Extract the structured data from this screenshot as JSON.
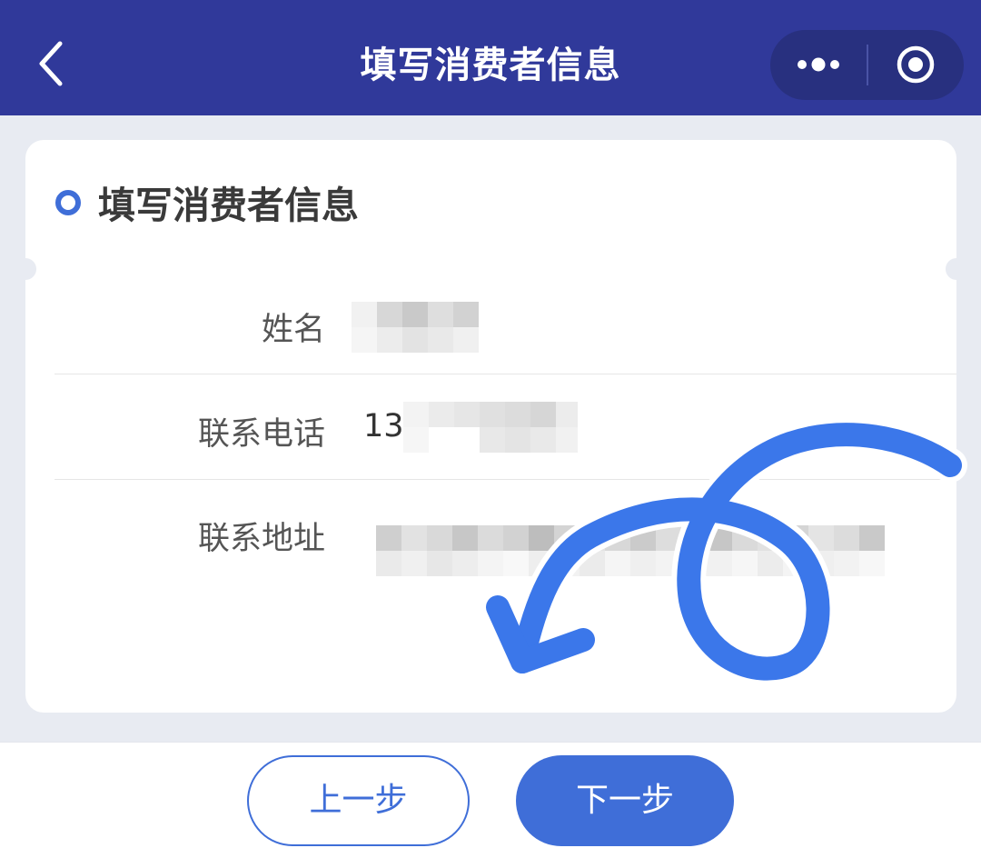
{
  "nav": {
    "title": "填写消费者信息",
    "back_icon": "chevron-left-icon",
    "more_icon": "more-dots-icon",
    "close_icon": "target-circle-icon",
    "background": "#30399a"
  },
  "section": {
    "title": "填写消费者信息"
  },
  "form": {
    "name": {
      "label": "姓名",
      "value": ""
    },
    "phone": {
      "label": "联系电话",
      "value": "13"
    },
    "address": {
      "label": "联系地址",
      "value": ""
    }
  },
  "footer": {
    "prev_label": "上一步",
    "next_label": "下一步"
  },
  "colors": {
    "accent": "#3f6ed8",
    "gesture": "#3b77ea",
    "page_bg": "#e8ebf2"
  },
  "gesture": {
    "icon": "swipe-back-gesture-icon"
  }
}
